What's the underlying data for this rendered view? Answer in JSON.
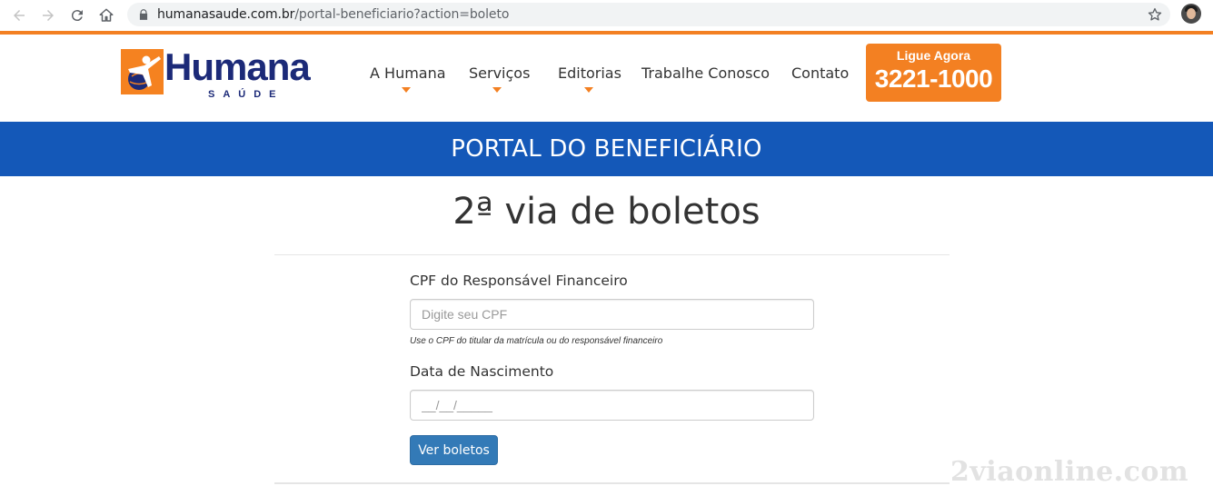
{
  "browser": {
    "url_host": "humanasaude.com.br",
    "url_path": "/portal-beneficiario?action=boleto"
  },
  "header": {
    "logo_text": "Humana",
    "logo_sub": "SAÚDE",
    "menu": [
      "A Humana",
      "Serviços",
      "Editorias",
      "Trabalhe Conosco",
      "Contato"
    ],
    "call_label": "Ligue Agora",
    "call_number": "3221-1000"
  },
  "banner": {
    "title": "PORTAL DO BENEFICIÁRIO"
  },
  "main": {
    "title": "2ª via de boletos",
    "cpf_label": "CPF do Responsável Financeiro",
    "cpf_placeholder": "Digite seu CPF",
    "cpf_help": "Use o CPF do titular da matrícula ou do responsável financeiro",
    "dob_label": "Data de Nascimento",
    "dob_placeholder": "__/__/_____",
    "submit_label": "Ver boletos"
  },
  "watermark": "2viaonline.com",
  "colors": {
    "accent_orange": "#f38022",
    "banner_blue": "#1458b8",
    "button_blue": "#337ab7",
    "logo_navy": "#1c2a78"
  }
}
